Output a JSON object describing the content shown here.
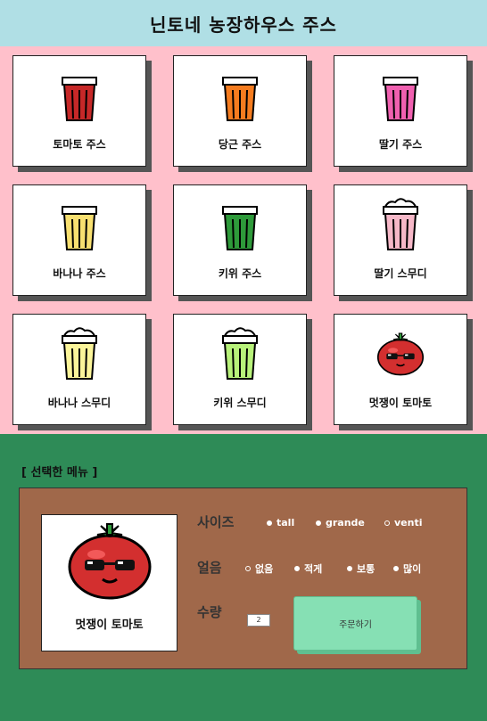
{
  "header": {
    "title": "닌토네 농장하우스 주스"
  },
  "menu": [
    {
      "label": "토마토 주스",
      "icon": "tomato-juice-cup-icon",
      "color": "#c62828",
      "kind": "juice"
    },
    {
      "label": "당근 주스",
      "icon": "carrot-juice-cup-icon",
      "color": "#f57c1f",
      "kind": "juice"
    },
    {
      "label": "딸기 주스",
      "icon": "strawberry-juice-cup-icon",
      "color": "#f060b0",
      "kind": "juice"
    },
    {
      "label": "바나나 주스",
      "icon": "banana-juice-cup-icon",
      "color": "#f8e070",
      "kind": "juice"
    },
    {
      "label": "키위 주스",
      "icon": "kiwi-juice-cup-icon",
      "color": "#2e9a3a",
      "kind": "juice"
    },
    {
      "label": "딸기 스무디",
      "icon": "strawberry-smoothie-cup-icon",
      "color": "#f6b8c8",
      "kind": "smoothie"
    },
    {
      "label": "바나나 스무디",
      "icon": "banana-smoothie-cup-icon",
      "color": "#fbf59a",
      "kind": "smoothie"
    },
    {
      "label": "키위 스무디",
      "icon": "kiwi-smoothie-cup-icon",
      "color": "#b8f27a",
      "kind": "smoothie"
    },
    {
      "label": "멋쟁이 토마토",
      "icon": "cool-tomato-icon",
      "color": "#c62828",
      "kind": "tomato"
    }
  ],
  "selected": {
    "title": "[ 선택한 메뉴 ]",
    "item_label": "멋쟁이 토마토",
    "item_icon": "cool-tomato-icon",
    "size_label": "사이즈",
    "sizes": [
      "tall",
      "grande",
      "venti"
    ],
    "size_selected": "venti",
    "ice_label": "얼음",
    "ice_options": [
      "없음",
      "적게",
      "보통",
      "많이"
    ],
    "ice_selected": "없음",
    "qty_label": "수량",
    "qty_value": "2",
    "order_label": "주문하기"
  }
}
